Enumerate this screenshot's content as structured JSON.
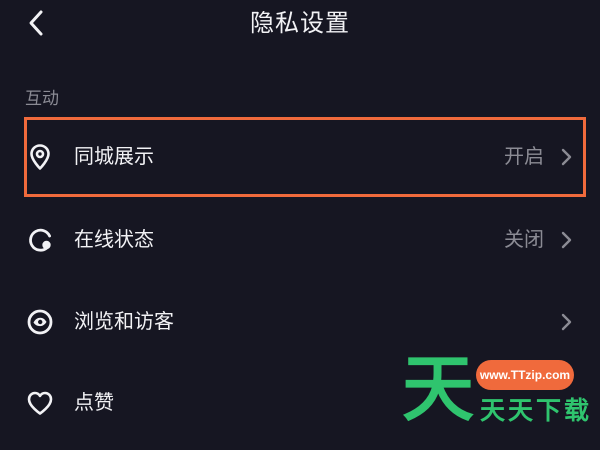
{
  "header": {
    "title": "隐私设置"
  },
  "section": {
    "label": "互动"
  },
  "rows": [
    {
      "label": "同城展示",
      "value": "开启",
      "icon": "location-pin-icon"
    },
    {
      "label": "在线状态",
      "value": "关闭",
      "icon": "online-status-icon"
    },
    {
      "label": "浏览和访客",
      "value": "",
      "icon": "eye-icon"
    },
    {
      "label": "点赞",
      "value": "",
      "icon": "heart-icon"
    }
  ],
  "highlight": {
    "color": "#f06a3c",
    "target": "同城展示"
  },
  "watermark": {
    "url": "www.TTzip.com",
    "text": "天天下载",
    "logo_glyph": "天",
    "url_color": "#f06a3c",
    "text_color": "#2fc46e"
  },
  "colors": {
    "background": "#161622",
    "primary_text": "#f2f2f5",
    "secondary_text": "#8b8b94"
  }
}
